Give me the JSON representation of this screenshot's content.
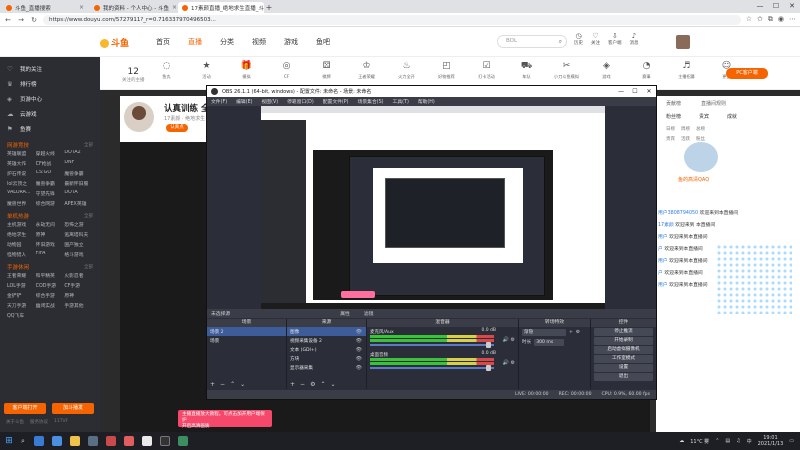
{
  "browser": {
    "tabs": [
      {
        "title": "斗鱼_直播搜索",
        "active": false
      },
      {
        "title": "我的资料 - 个人中心 - 斗鱼",
        "active": false
      },
      {
        "title": "17素颜直播_绝地求生直播_斗鱼直",
        "active": true
      }
    ],
    "url": "https://www.douyu.com/5727911?_r=0.716337970496503...",
    "win_controls": [
      "—",
      "☐",
      "✕"
    ]
  },
  "site": {
    "logo": "斗鱼",
    "nav": [
      "首页",
      "直播",
      "分类",
      "视频",
      "游戏",
      "鱼吧"
    ],
    "nav_active_index": 1,
    "search_text": "BOL",
    "header_icons": [
      {
        "label": "历史",
        "icon": "clock-icon"
      },
      {
        "label": "关注",
        "icon": "heart-icon"
      },
      {
        "label": "客户端",
        "icon": "download-icon"
      },
      {
        "label": "消息",
        "icon": "bell-icon"
      }
    ]
  },
  "sidebar": {
    "main": [
      {
        "label": "我的关注",
        "icon": "heart-icon"
      },
      {
        "label": "排行榜",
        "icon": "trophy-icon"
      },
      {
        "label": "页游中心",
        "icon": "gamepad-icon"
      },
      {
        "label": "云游戏",
        "icon": "cloud-icon"
      },
      {
        "label": "鱼赛",
        "icon": "flag-icon"
      }
    ],
    "sections": [
      {
        "title": "网游竞技",
        "more": "全部",
        "items": [
          "英雄联盟",
          "穿越火线",
          "DOTA2",
          "英雄大作",
          "CF枪战",
          "DNF",
          "炉石传说",
          "CS:GO",
          "魔兽争霸",
          "lol云顶之",
          "魔兽争霸",
          "最新怀旧服",
          "VALORA...",
          "守望先锋",
          "DOTA",
          "魔兽世界",
          "综合网游",
          "APEX英雄"
        ]
      },
      {
        "title": "单机热游",
        "more": "全部",
        "items": [
          "主机游戏",
          "永劫无间",
          "恐怖之游",
          "绝地求生",
          "原神",
          "逃离塔科夫",
          "动物园",
          "怀旧游戏",
          "国产独立",
          "怪物猎人",
          "FIFA",
          "格斗游戏"
        ]
      },
      {
        "title": "手游休闲",
        "more": "全部",
        "items": [
          "王者荣耀",
          "和平精英",
          "火影忍者",
          "LOL手游",
          "COD手游",
          "CF手游",
          "金铲铲",
          "综合手游",
          "原神",
          "天刀手游",
          "幽闭实战",
          "手游其他",
          "QQ飞车"
        ]
      }
    ],
    "bottom_buttons": [
      "客户端打开",
      "加斗播发"
    ],
    "footer": [
      "关于斗鱼",
      "服务协议",
      "11TVF"
    ]
  },
  "category_bar": {
    "counter": "12",
    "counter_label": "关注的主播",
    "items": [
      {
        "label": "鱼丸",
        "icon": "fish-icon"
      },
      {
        "label": "活动",
        "icon": "star-icon"
      },
      {
        "label": "模拟",
        "icon": "gift-icon"
      },
      {
        "label": "CF",
        "icon": "target-icon"
      },
      {
        "label": "棋牌",
        "icon": "dice-icon"
      },
      {
        "label": "王者荣耀",
        "icon": "crown-icon"
      },
      {
        "label": "火力全开",
        "icon": "fire-icon"
      },
      {
        "label": "好物推荐",
        "icon": "bag-icon"
      },
      {
        "label": "打卡活动",
        "icon": "check-icon"
      },
      {
        "label": "车队",
        "icon": "car-icon"
      },
      {
        "label": "小刀斗鱼模拟",
        "icon": "knife-icon"
      },
      {
        "label": "游戏",
        "icon": "gamepad-icon"
      },
      {
        "label": "赛事",
        "icon": "speedometer-icon"
      },
      {
        "label": "主播招募",
        "icon": "mic-icon"
      },
      {
        "label": "更多",
        "icon": "smile-icon"
      }
    ],
    "pc_button": "PC客户端"
  },
  "room": {
    "title": "认真训练 全",
    "sub": "17素颜 · 绝地求生",
    "tag": "认真点"
  },
  "right_panel": {
    "top": [
      "贡献榜",
      "直播间规则"
    ],
    "tabs": [
      "粉丝榜",
      "贵宾",
      "成就"
    ],
    "grid": [
      "日榜",
      "周榜",
      "总榜",
      "贵宾",
      "活跃",
      "粉丝"
    ],
    "fan_badge": "超粉",
    "fan_name": "鱼的高清QAQ",
    "chat": [
      {
        "user": "用户3808794050",
        "text": "欢迎来到本直播间"
      },
      {
        "user": "17素颜",
        "text": "欢迎来到 本直播间"
      },
      {
        "user": "用户",
        "text": "欢迎来到本直播间"
      },
      {
        "user": "户",
        "text": "欢迎来到本直播间"
      },
      {
        "user": "用户",
        "text": "欢迎来到本直播间"
      },
      {
        "user": "户",
        "text": "欢迎来到本直播间"
      },
      {
        "user": "用户",
        "text": "欢迎来到本直播间"
      }
    ]
  },
  "obs": {
    "title": "OBS 26.1.1 (64-bit, windows) - 配置文件: 未命名 - 场景: 未命名",
    "menu": [
      "文件(F)",
      "编辑(E)",
      "视图(V)",
      "停靠窗口(D)",
      "配置文件(P)",
      "场景集合(S)",
      "工具(T)",
      "帮助(H)"
    ],
    "scene_info": "未选择源",
    "scene_info_right": [
      "属性",
      "滤镜"
    ],
    "docks": {
      "scenes": {
        "title": "场景",
        "items": [
          "场景 2",
          "场景"
        ]
      },
      "sources": {
        "title": "来源",
        "items": [
          "图像",
          "视频采集设备 2",
          "文本 (GDI+)",
          "方块",
          "显示器采集"
        ]
      },
      "mixer": {
        "title": "混音器",
        "channels": [
          {
            "name": "麦克风/Aux",
            "db": "0.0 dB"
          },
          {
            "name": "桌面音频",
            "db": "0.0 dB"
          }
        ]
      },
      "transitions": {
        "title": "转场特效",
        "type": "渐隐",
        "duration_label": "时长",
        "duration": "300 ms"
      },
      "controls": {
        "title": "控件",
        "buttons": [
          "停止推流",
          "开始录制",
          "启动虚拟摄像机",
          "工作室模式",
          "设置",
          "退出"
        ]
      }
    },
    "status": {
      "live": "LIVE: 00:00:00",
      "rec": "REC: 00:00:00",
      "cpu": "CPU: 0.9%, 60.00 fps"
    }
  },
  "toast": "主播直播放大教程。可点击加开用户端保护\n开启高清画质",
  "taskbar": {
    "weather": "11°C 雾",
    "ime": "中",
    "time": "19:01",
    "date": "2021/1/13"
  }
}
